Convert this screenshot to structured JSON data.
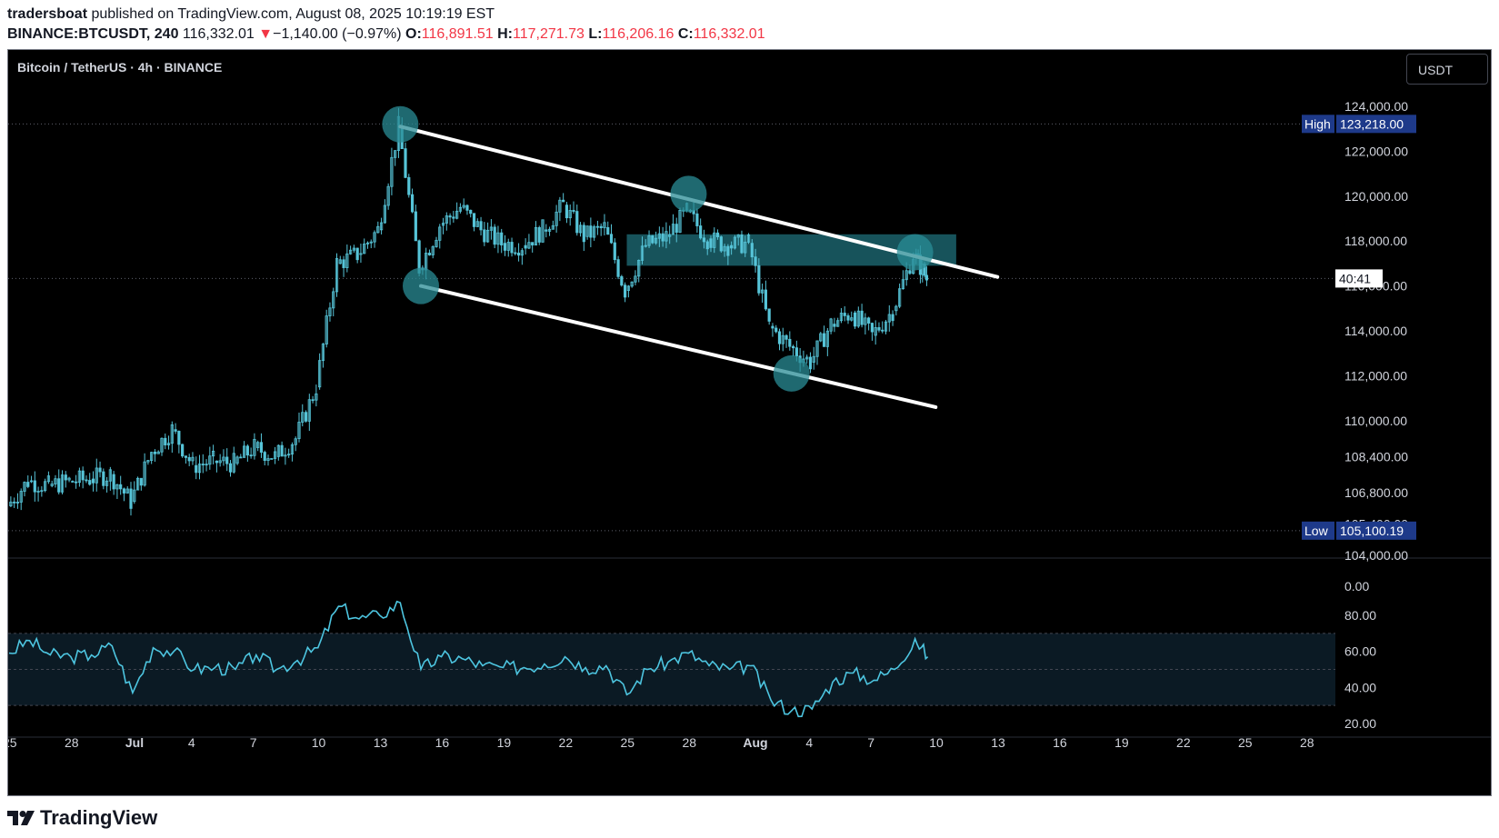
{
  "header": {
    "author": "tradersboat",
    "published": " published on TradingView.com, August 08, 2025 10:19:19 EST",
    "symbol": "BINANCE:BTCUSDT, 240",
    "price": "116,332.01",
    "arrow": "▼",
    "change": "−1,140.00 (−0.97%)",
    "o_label": "O:",
    "o_value": "116,891.51",
    "h_label": "H:",
    "h_value": "117,271.73",
    "l_label": "L:",
    "l_value": "116,206.16",
    "c_label": "C:",
    "c_value": "116,332.01"
  },
  "legend_title": "Bitcoin / TetherUS · 4h · BINANCE",
  "currency_button": "USDT",
  "footer": {
    "brand": "TradingView"
  },
  "colors": {
    "candle": "#56c4d8",
    "rsi": "#4dc5e0",
    "lines": "#ffffff",
    "zone": "#1f6f7a",
    "circle": "#2a8c95",
    "label_bg": "#1e3a8a"
  },
  "chart_data": [
    {
      "type": "candlestick",
      "title": "Bitcoin / TetherUS · 4h · BINANCE",
      "x_tick_labels": [
        "25",
        "28",
        "Jul",
        "4",
        "7",
        "10",
        "13",
        "16",
        "19",
        "22",
        "25",
        "28",
        "Aug",
        "4",
        "7",
        "10",
        "13",
        "16",
        "19",
        "22",
        "25",
        "28"
      ],
      "y_tick_labels": [
        "124,000.00",
        "122,000.00",
        "120,000.00",
        "118,000.00",
        "116,000.00",
        "114,000.00",
        "112,000.00",
        "110,000.00",
        "108,400.00",
        "106,800.00",
        "105,400.00",
        "104,000.00"
      ],
      "ylim": [
        103700,
        125100
      ],
      "x_range": [
        "2025-06-25",
        "2025-08-28"
      ],
      "high_label": "High",
      "high_value": "123,218.00",
      "low_label": "Low",
      "low_value": "105,100.19",
      "countdown": "40:41",
      "close_series_approx": [
        {
          "d": "2025-06-25",
          "v": 106200
        },
        {
          "d": "2025-06-26",
          "v": 107300
        },
        {
          "d": "2025-06-27",
          "v": 107100
        },
        {
          "d": "2025-06-28",
          "v": 107300
        },
        {
          "d": "2025-06-29",
          "v": 107400
        },
        {
          "d": "2025-06-30",
          "v": 107600
        },
        {
          "d": "2025-07-01",
          "v": 106400
        },
        {
          "d": "2025-07-02",
          "v": 108600
        },
        {
          "d": "2025-07-03",
          "v": 109600
        },
        {
          "d": "2025-07-04",
          "v": 108000
        },
        {
          "d": "2025-07-05",
          "v": 108200
        },
        {
          "d": "2025-07-06",
          "v": 108100
        },
        {
          "d": "2025-07-07",
          "v": 108800
        },
        {
          "d": "2025-07-08",
          "v": 108400
        },
        {
          "d": "2025-07-09",
          "v": 109200
        },
        {
          "d": "2025-07-10",
          "v": 111500
        },
        {
          "d": "2025-07-11",
          "v": 117000
        },
        {
          "d": "2025-07-12",
          "v": 117400
        },
        {
          "d": "2025-07-13",
          "v": 118500
        },
        {
          "d": "2025-07-14",
          "v": 123100
        },
        {
          "d": "2025-07-15",
          "v": 116800
        },
        {
          "d": "2025-07-16",
          "v": 118700
        },
        {
          "d": "2025-07-17",
          "v": 119500
        },
        {
          "d": "2025-07-18",
          "v": 118500
        },
        {
          "d": "2025-07-19",
          "v": 117900
        },
        {
          "d": "2025-07-20",
          "v": 117800
        },
        {
          "d": "2025-07-21",
          "v": 118500
        },
        {
          "d": "2025-07-22",
          "v": 119600
        },
        {
          "d": "2025-07-23",
          "v": 118200
        },
        {
          "d": "2025-07-24",
          "v": 118600
        },
        {
          "d": "2025-07-25",
          "v": 115800
        },
        {
          "d": "2025-07-26",
          "v": 117800
        },
        {
          "d": "2025-07-27",
          "v": 118200
        },
        {
          "d": "2025-07-28",
          "v": 119300
        },
        {
          "d": "2025-07-29",
          "v": 118100
        },
        {
          "d": "2025-07-30",
          "v": 117800
        },
        {
          "d": "2025-07-31",
          "v": 117900
        },
        {
          "d": "2025-08-01",
          "v": 114200
        },
        {
          "d": "2025-08-02",
          "v": 113300
        },
        {
          "d": "2025-08-03",
          "v": 112600
        },
        {
          "d": "2025-08-04",
          "v": 114300
        },
        {
          "d": "2025-08-05",
          "v": 114800
        },
        {
          "d": "2025-08-06",
          "v": 113800
        },
        {
          "d": "2025-08-07",
          "v": 114900
        },
        {
          "d": "2025-08-08",
          "v": 117400
        },
        {
          "d": "2025-08-08",
          "v": 116332
        }
      ],
      "trendlines": [
        {
          "name": "upper",
          "from": {
            "d": "2025-07-14",
            "v": 123100
          },
          "to": {
            "d": "2025-08-12",
            "v": 116400
          }
        },
        {
          "name": "lower",
          "from": {
            "d": "2025-07-15",
            "v": 116000
          },
          "to": {
            "d": "2025-08-09",
            "v": 110600
          }
        }
      ],
      "zone": {
        "from": "2025-07-25",
        "to": "2025-08-10",
        "low": 116900,
        "high": 118300
      },
      "markers": [
        {
          "d": "2025-07-14",
          "v": 123200
        },
        {
          "d": "2025-07-15",
          "v": 116000
        },
        {
          "d": "2025-07-28",
          "v": 120100
        },
        {
          "d": "2025-08-02",
          "v": 112100
        },
        {
          "d": "2025-08-08",
          "v": 117500
        }
      ]
    },
    {
      "type": "line",
      "title": "",
      "y_tick_labels": [
        "0.00",
        "80.00",
        "60.00",
        "40.00",
        "20.00"
      ],
      "ylim": [
        18,
        100
      ],
      "band": [
        30,
        70
      ],
      "values_approx": [
        {
          "d": "2025-06-25",
          "v": 59
        },
        {
          "d": "2025-06-26",
          "v": 66
        },
        {
          "d": "2025-06-27",
          "v": 58
        },
        {
          "d": "2025-06-28",
          "v": 57
        },
        {
          "d": "2025-06-29",
          "v": 58
        },
        {
          "d": "2025-06-30",
          "v": 63
        },
        {
          "d": "2025-07-01",
          "v": 37
        },
        {
          "d": "2025-07-02",
          "v": 62
        },
        {
          "d": "2025-07-03",
          "v": 60
        },
        {
          "d": "2025-07-04",
          "v": 50
        },
        {
          "d": "2025-07-05",
          "v": 51
        },
        {
          "d": "2025-07-06",
          "v": 50
        },
        {
          "d": "2025-07-07",
          "v": 58
        },
        {
          "d": "2025-07-08",
          "v": 50
        },
        {
          "d": "2025-07-09",
          "v": 55
        },
        {
          "d": "2025-07-10",
          "v": 62
        },
        {
          "d": "2025-07-11",
          "v": 85
        },
        {
          "d": "2025-07-12",
          "v": 78
        },
        {
          "d": "2025-07-13",
          "v": 80
        },
        {
          "d": "2025-07-14",
          "v": 87
        },
        {
          "d": "2025-07-15",
          "v": 50
        },
        {
          "d": "2025-07-16",
          "v": 57
        },
        {
          "d": "2025-07-17",
          "v": 56
        },
        {
          "d": "2025-07-18",
          "v": 52
        },
        {
          "d": "2025-07-19",
          "v": 51
        },
        {
          "d": "2025-07-20",
          "v": 51
        },
        {
          "d": "2025-07-21",
          "v": 53
        },
        {
          "d": "2025-07-22",
          "v": 57
        },
        {
          "d": "2025-07-23",
          "v": 51
        },
        {
          "d": "2025-07-24",
          "v": 52
        },
        {
          "d": "2025-07-25",
          "v": 36
        },
        {
          "d": "2025-07-26",
          "v": 50
        },
        {
          "d": "2025-07-27",
          "v": 54
        },
        {
          "d": "2025-07-28",
          "v": 59
        },
        {
          "d": "2025-07-29",
          "v": 52
        },
        {
          "d": "2025-07-30",
          "v": 50
        },
        {
          "d": "2025-07-31",
          "v": 52
        },
        {
          "d": "2025-08-01",
          "v": 33
        },
        {
          "d": "2025-08-02",
          "v": 27
        },
        {
          "d": "2025-08-03",
          "v": 28
        },
        {
          "d": "2025-08-04",
          "v": 43
        },
        {
          "d": "2025-08-05",
          "v": 48
        },
        {
          "d": "2025-08-06",
          "v": 44
        },
        {
          "d": "2025-08-07",
          "v": 50
        },
        {
          "d": "2025-08-08",
          "v": 67
        },
        {
          "d": "2025-08-08",
          "v": 57
        }
      ]
    }
  ]
}
